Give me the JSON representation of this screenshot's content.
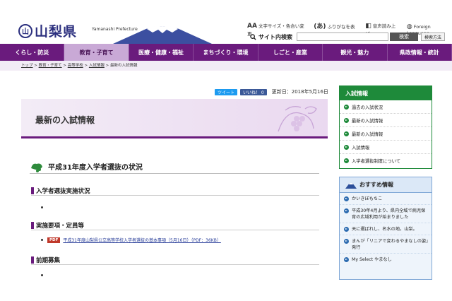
{
  "header": {
    "logo_mark": "山",
    "logo_text": "山梨県",
    "logo_sub": "Yamanashi Prefecture",
    "util": [
      "文字サイズ・色合い変更",
      "ふりがなを表示",
      "音声読み上げ",
      "Foreign Language"
    ],
    "util_icons": [
      "AA",
      "(あ)",
      "◧",
      "◍"
    ],
    "search_label": "サイト内検索",
    "search_button": "検索",
    "search_option": "検索方法"
  },
  "nav": {
    "items": [
      "くらし・防災",
      "教育・子育て",
      "医療・健康・福祉",
      "まちづくり・環境",
      "しごと・産業",
      "観光・魅力",
      "県政情報・統計"
    ],
    "active_index": 1
  },
  "breadcrumb": {
    "items": [
      "トップ",
      "教育・子育て",
      "高等学校",
      "入試情報",
      "最新の入試情報"
    ],
    "sep": " > "
  },
  "share": {
    "tweet": "ツイート",
    "like": "いいね！ 0",
    "updated": "更新日：2018年5月16日"
  },
  "main": {
    "page_title": "最新の入試情報",
    "h2": "平成31年度入学者選抜の状況",
    "sections": [
      "入学者選抜実施状況",
      "実施要項・定員等",
      "前期募集"
    ],
    "pdf_badge": "PDF",
    "pdf_link": "平成31年度山梨県公立高等学校入学者選抜の基本事項（5月16日）（PDF：36KB）"
  },
  "sidebar": {
    "box1_title": "入試情報",
    "box1_items": [
      "過去の入試状況",
      "最新の入試情報",
      "最新の入試情報",
      "入試情報",
      "入学者選抜制度について"
    ],
    "box2_title": "おすすめ情報",
    "box2_items": [
      "かいきぼもちこ",
      "平成30年4月より、県内全域で病児保育の広域利用が始まりました",
      "天に選ばれし、名水の地。山梨。",
      "まんが「リニアで変わるやまなしの姿」発行",
      "My Select やまなし"
    ]
  },
  "colors": {
    "nav": "#6a1b7d",
    "active_nav": "#c9a9d6",
    "green": "#1e8a3a",
    "blue_box": "#7fa7d6"
  }
}
